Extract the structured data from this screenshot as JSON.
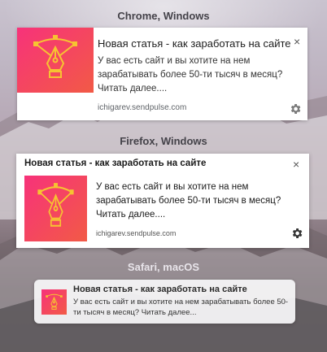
{
  "colors": {
    "brand_gradient_start": "#f7327a",
    "brand_gradient_end": "#f25a46",
    "accent": "#f6c431"
  },
  "chrome": {
    "label": "Chrome, Windows",
    "title": "Новая статья - как заработать на сайте",
    "body": "У вас есть сайт и вы хотите на нем зарабатывать более 50-ти тысяч в месяц? Читать далее....",
    "site": "ichigarev.sendpulse.com",
    "close": "×",
    "icons": [
      "pen-tool-logo-icon",
      "close-icon",
      "gear-icon"
    ]
  },
  "firefox": {
    "label": "Firefox, Windows",
    "title": "Новая статья - как заработать на сайте",
    "body": "У вас есть сайт и вы хотите на нем зарабатывать более 50-ти тысяч в месяц? Читать далее....",
    "site": "ichigarev.sendpulse.com",
    "close": "×",
    "icons": [
      "pen-tool-logo-icon",
      "close-icon",
      "gear-icon"
    ]
  },
  "safari": {
    "label": "Safari, macOS",
    "title": "Новая статья - как заработать на сайте",
    "body": "У вас есть сайт и вы хотите на нем зарабатывать более 50-ти тысяч в месяц? Читать далее...",
    "icons": [
      "pen-tool-logo-icon"
    ]
  }
}
